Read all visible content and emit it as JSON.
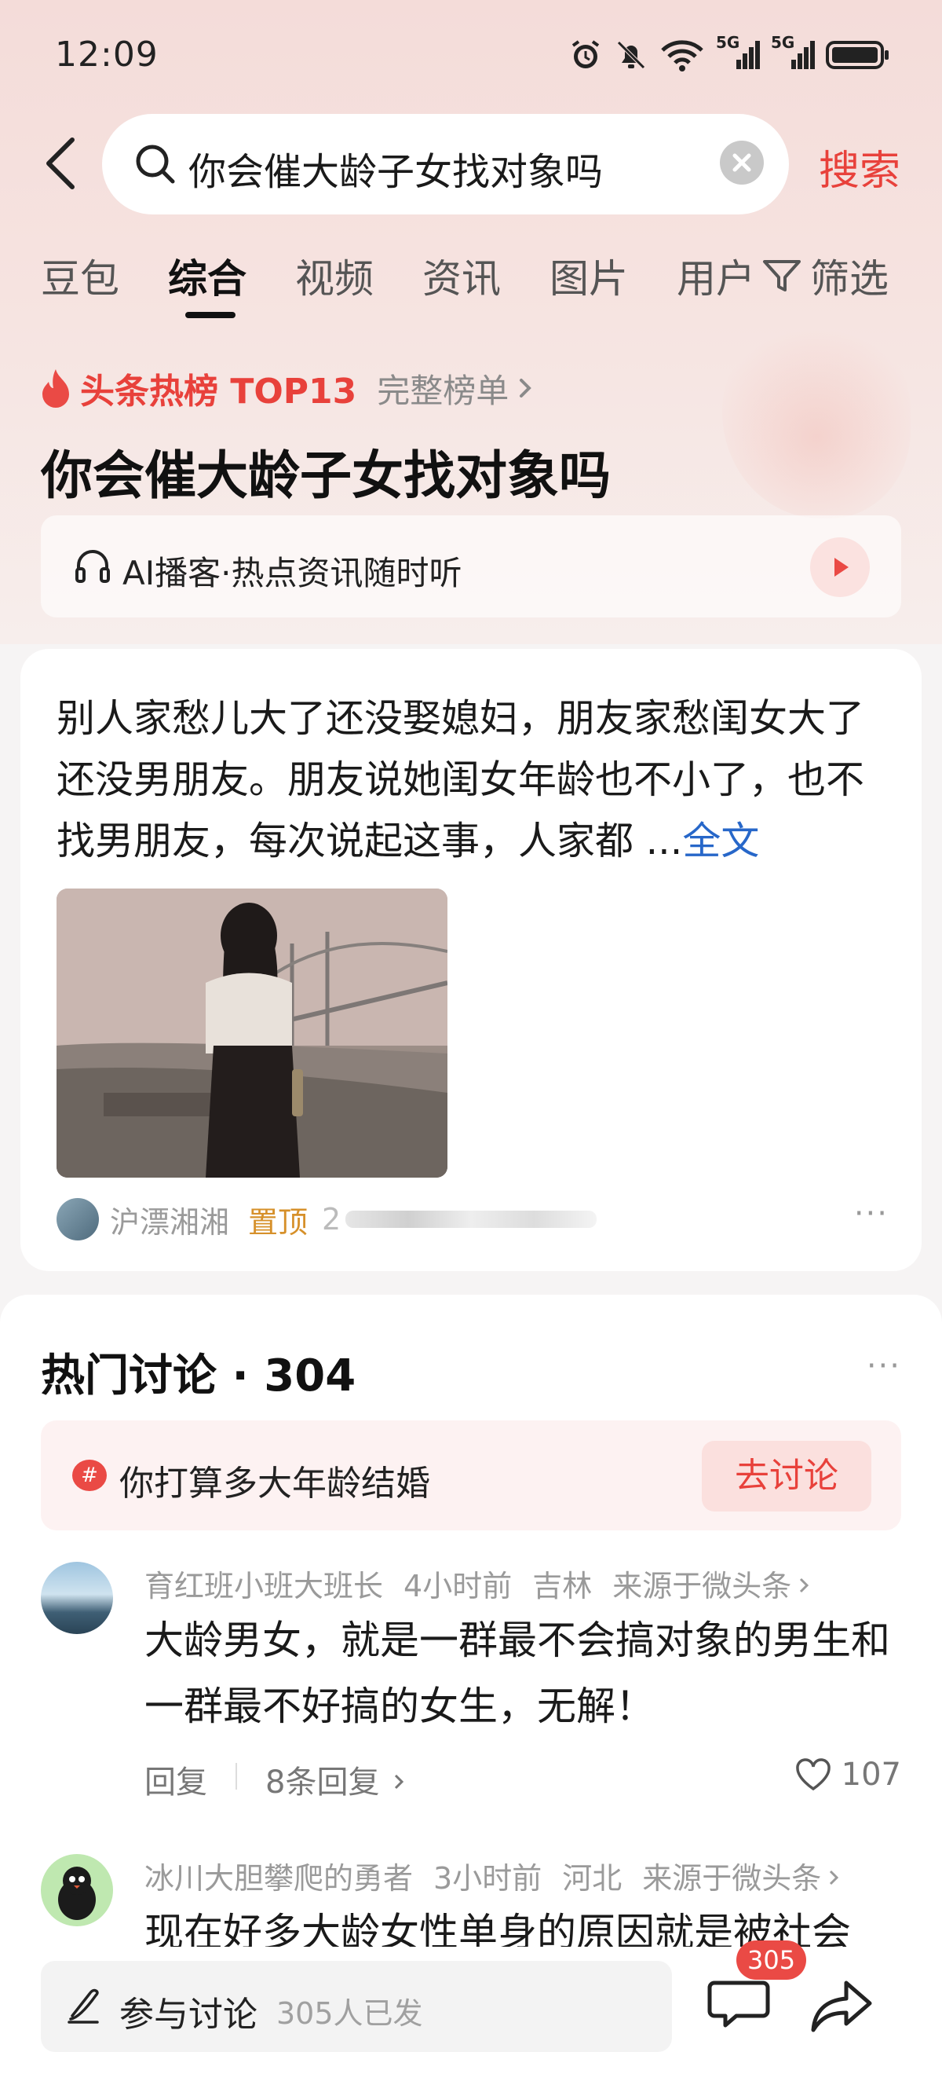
{
  "status_bar": {
    "time": "12:09",
    "network_1": "5G",
    "network_2": "5G"
  },
  "search": {
    "query": "你会催大龄子女找对象吗",
    "action_label": "搜索"
  },
  "tabs": [
    {
      "label": "豆包"
    },
    {
      "label": "综合"
    },
    {
      "label": "视频"
    },
    {
      "label": "资讯"
    },
    {
      "label": "图片"
    },
    {
      "label": "用户"
    }
  ],
  "filter_label": "筛选",
  "hot_rank": {
    "label": "头条热榜 TOP13",
    "full_list_label": "完整榜单"
  },
  "headline": "你会催大龄子女找对象吗",
  "ai_podcast": {
    "label": "AI播客·热点资讯随时听"
  },
  "post": {
    "text": "别人家愁儿大了还没娶媳妇，朋友家愁闺女大了还没男朋友。朋友说她闺女年龄也不小了，也不找男朋友，每次说起这事，人家都 ...",
    "more_label": "全文",
    "author": "沪漂湘湘",
    "pin_label": "置顶",
    "blurred_prefix": "2"
  },
  "discussion": {
    "title": "热门讨论 · 304",
    "topic": "你打算多大年龄结婚",
    "go_label": "去讨论",
    "comments": [
      {
        "user": "育红班小班大班长",
        "time": "4小时前",
        "location": "吉林",
        "source": "来源于微头条",
        "text": "大龄男女，就是一群最不会搞对象的男生和一群最不好搞的女生，无解！",
        "reply_label": "回复",
        "replies_label": "8条回复",
        "likes": "107"
      },
      {
        "user": "冰川大胆攀爬的勇者",
        "time": "3小时前",
        "location": "河北",
        "source": "来源于微头条",
        "text": "现在好多大龄女性单身的原因就是被社会"
      }
    ]
  },
  "bottom_bar": {
    "input_label": "参与讨论",
    "participants": "305人已发",
    "comment_count": "305"
  },
  "colors": {
    "accent": "#e8413b",
    "link": "#2767c9",
    "pin": "#d6902a"
  }
}
